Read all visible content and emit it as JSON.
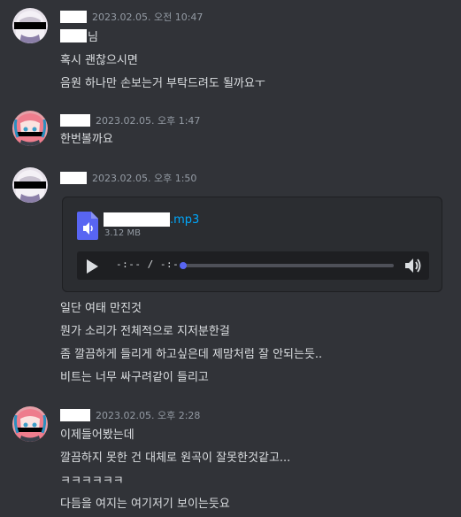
{
  "messages": [
    {
      "timestamp": "2023.02.05. 오전 10:47",
      "avatar": "anime-avatar-white-hair",
      "lines": [
        {
          "redacted_prefix": true,
          "text": "님"
        },
        {
          "text": "혹시 괜찮으시면"
        },
        {
          "text": "음원 하나만 손보는거 부탁드려도 될까요ㅜ"
        }
      ]
    },
    {
      "timestamp": "2023.02.05. 오후 1:47",
      "avatar": "anime-avatar-pink-hair",
      "lines": [
        {
          "text": "한번볼까요"
        }
      ]
    },
    {
      "timestamp": "2023.02.05. 오후 1:50",
      "avatar": "anime-avatar-white-hair",
      "attachment": {
        "file_ext": ".mp3",
        "file_size": "3.12 MB",
        "player_time": "-:-- / -:--",
        "icon": "audio-file-icon"
      },
      "lines": [
        {
          "text": "일단 여태 만진것"
        },
        {
          "text": "뭔가 소리가 전체적으로 지저분한걸"
        },
        {
          "text": "좀 깔끔하게 들리게 하고싶은데 제맘처럼 잘 안되는듯.."
        },
        {
          "text": "비트는 너무 싸구려같이 들리고"
        }
      ]
    },
    {
      "timestamp": "2023.02.05. 오후 2:28",
      "avatar": "anime-avatar-pink-hair",
      "lines": [
        {
          "text": "이제들어봤는데"
        },
        {
          "text": "깔끔하지 못한 건 대체로 원곡이 잘못한것같고..."
        },
        {
          "text": "ㅋㅋㅋㅋㅋㅋ"
        },
        {
          "text": "다듬을 여지는 여기저기 보이는듯요"
        }
      ]
    }
  ],
  "colors": {
    "background": "#313338",
    "text": "#dbdee1",
    "muted": "#949ba4",
    "link": "#00a8fc",
    "accent": "#5865f2"
  }
}
